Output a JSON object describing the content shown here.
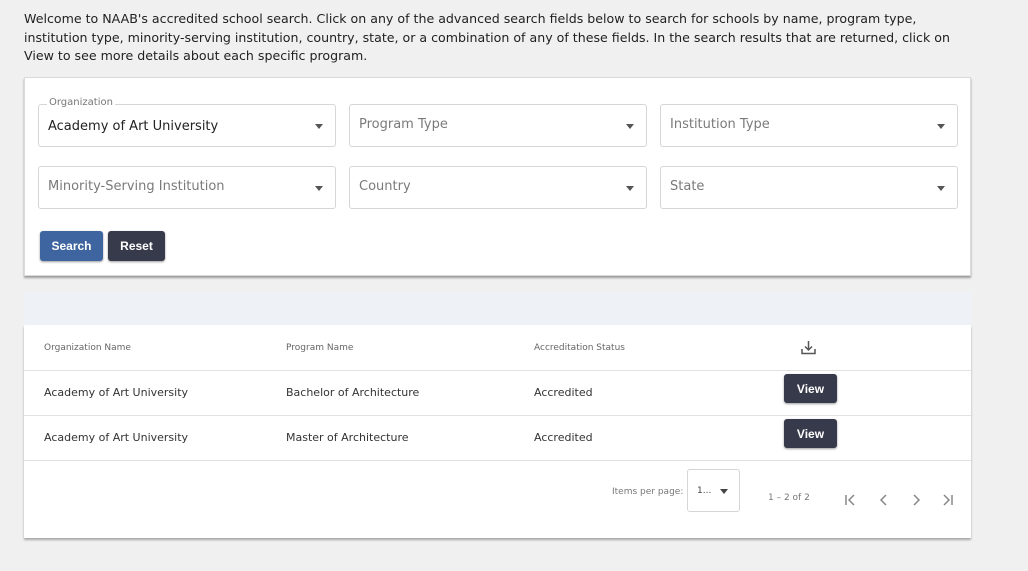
{
  "intro": {
    "text": "Welcome to NAAB's accredited school search. Click on any of the advanced search fields below to search for schools by name, program type, institution type, minority-serving institution, country, state, or a combination of any of these fields. In the search results that are returned, click on View to see more details about each specific program."
  },
  "filters": {
    "organization": {
      "caption": "Organization",
      "value": "Academy of Art University"
    },
    "program_type": {
      "placeholder": "Program Type"
    },
    "institution_type": {
      "placeholder": "Institution Type"
    },
    "minority_serving": {
      "placeholder": "Minority-Serving Institution"
    },
    "country": {
      "placeholder": "Country"
    },
    "state": {
      "placeholder": "State"
    }
  },
  "buttons": {
    "search": "Search",
    "reset": "Reset"
  },
  "table": {
    "headers": [
      "Organization Name",
      "Program Name",
      "Accreditation Status"
    ],
    "rows": [
      {
        "organization": "Academy of Art University",
        "program": "Bachelor of Architecture",
        "status": "Accredited",
        "action": "View"
      },
      {
        "organization": "Academy of Art University",
        "program": "Master of Architecture",
        "status": "Accredited",
        "action": "View"
      }
    ]
  },
  "pagination": {
    "items_per_page_label": "Items per page:",
    "items_per_page_value": "1...",
    "range": "1 – 2 of 2"
  },
  "colors": {
    "primary": "#3e65a0",
    "dark": "#363a4a",
    "band": "#eef1f6"
  },
  "icons": [
    "download-icon",
    "first-page-icon",
    "prev-page-icon",
    "next-page-icon",
    "last-page-icon",
    "chevron-down-icon"
  ]
}
